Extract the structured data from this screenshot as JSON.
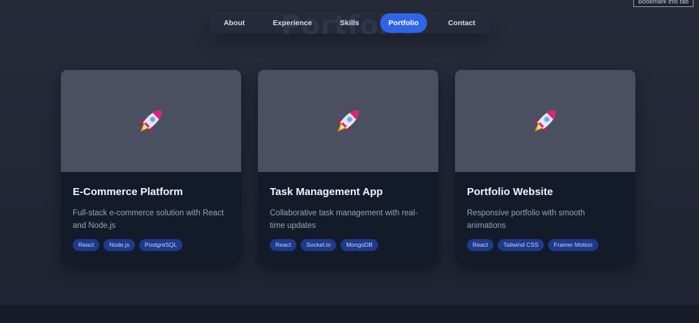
{
  "tooltip": "Bookmark this tab",
  "section_watermark": "Portfolio",
  "nav": {
    "items": [
      {
        "label": "About"
      },
      {
        "label": "Experience"
      },
      {
        "label": "Skills"
      },
      {
        "label": "Portfolio",
        "active": true
      },
      {
        "label": "Contact"
      }
    ]
  },
  "projects": [
    {
      "image_icon": "rocket-icon",
      "title": "E-Commerce Platform",
      "description": "Full-stack e-commerce solution with React and Node.js",
      "tags": [
        "React",
        "Node.js",
        "PostgreSQL"
      ]
    },
    {
      "image_icon": "rocket-icon",
      "title": "Task Management App",
      "description": "Collaborative task management with real-time updates",
      "tags": [
        "React",
        "Socket.io",
        "MongoDB"
      ]
    },
    {
      "image_icon": "rocket-icon",
      "title": "Portfolio Website",
      "description": "Responsive portfolio with smooth animations",
      "tags": [
        "React",
        "Tailwind CSS",
        "Framer Motion"
      ]
    }
  ],
  "colors": {
    "accent": "#2f64e9",
    "tag_bg": "#1e3a8a",
    "card_bg": "#131a2a",
    "image_bg": "#4a5062"
  }
}
